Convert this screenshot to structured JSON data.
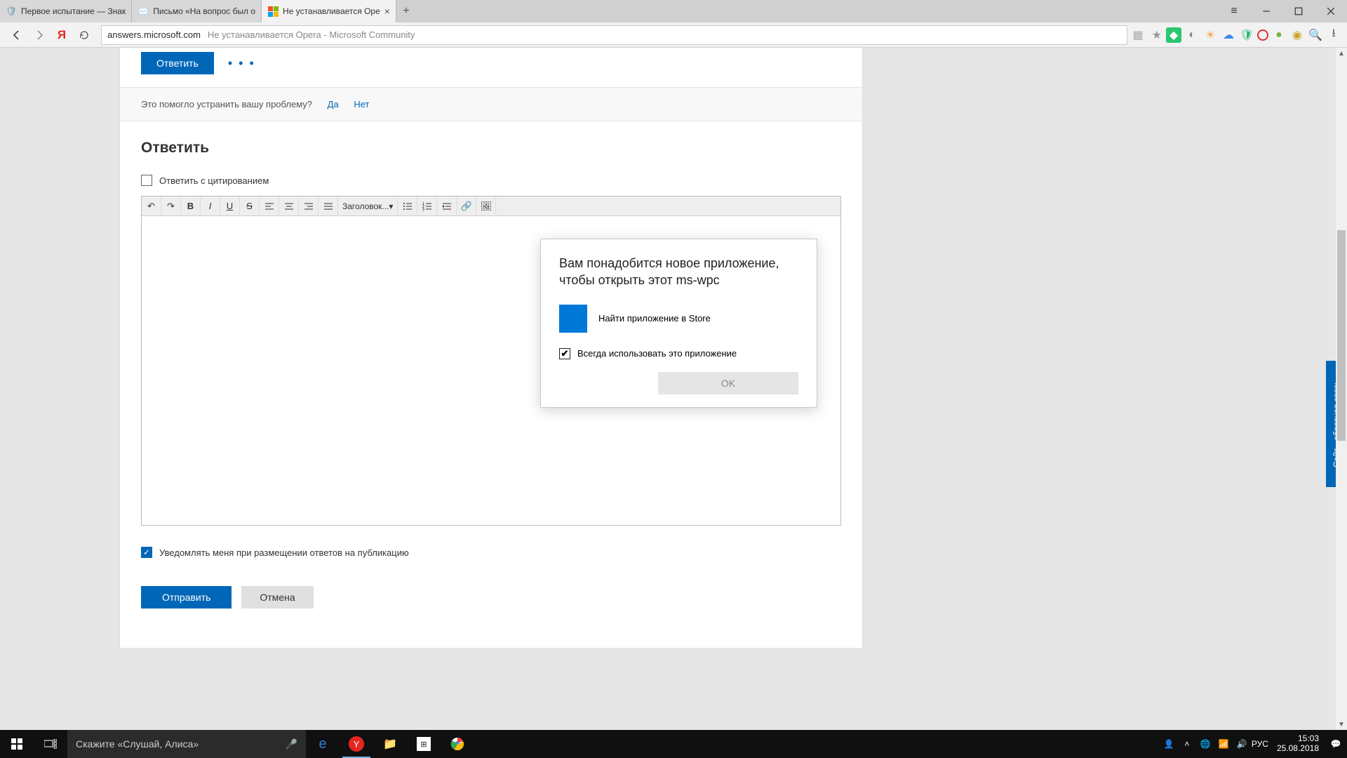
{
  "tabs": [
    {
      "title": "Первое испытание — Знак"
    },
    {
      "title": "Письмо «На вопрос был о"
    },
    {
      "title": "Не устанавливается Оpe"
    }
  ],
  "window_controls": {
    "menu": "≡"
  },
  "address": {
    "domain": "answers.microsoft.com",
    "page_title": "Не устанавливается Opera - Microsoft Community"
  },
  "page": {
    "reply_button": "Ответить",
    "helpful_prompt": "Это помогло устранить вашу проблему?",
    "helpful_yes": "Да",
    "helpful_no": "Нет",
    "reply_heading": "Ответить",
    "quote_label": "Ответить с цитированием",
    "heading_select": "Заголовок...",
    "notify_label": "Уведомлять меня при размещении ответов на публикацию",
    "submit": "Отправить",
    "cancel": "Отмена"
  },
  "feedback_tab": "Сайт - обратная связь",
  "dialog": {
    "title": "Вам понадобится новое приложение, чтобы открыть этот ms-wpc",
    "store_option": "Найти приложение в Store",
    "always": "Всегда использовать это приложение",
    "ok": "OK"
  },
  "taskbar": {
    "search_placeholder": "Скажите «Слушай, Алиса»",
    "lang": "РУС",
    "time": "15:03",
    "date": "25.08.2018"
  }
}
